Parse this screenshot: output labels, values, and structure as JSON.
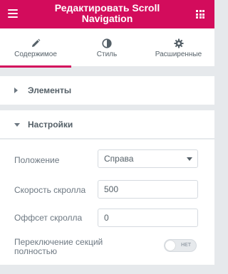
{
  "header": {
    "title": "Редактировать Scroll Navigation",
    "menu_icon": "hamburger-menu-icon",
    "grid_icon": "apps-grid-icon",
    "color": "#d30c5c"
  },
  "tabs": [
    {
      "label": "Содержимое",
      "icon": "pencil-icon",
      "active": true
    },
    {
      "label": "Стиль",
      "icon": "half-circle-icon",
      "active": false
    },
    {
      "label": "Расширенные",
      "icon": "gear-icon",
      "active": false
    }
  ],
  "sections": {
    "elements": {
      "title": "Элементы",
      "expanded": false
    },
    "settings": {
      "title": "Настройки",
      "expanded": true
    }
  },
  "settings": {
    "position": {
      "label": "Положение",
      "value": "Справа"
    },
    "scroll_speed": {
      "label": "Скорость скролла",
      "value": "500"
    },
    "scroll_offset": {
      "label": "Оффсет скролла",
      "value": "0"
    },
    "full_section": {
      "label": "Переключение секций полностью",
      "toggle_text": "НЕТ",
      "on": false
    }
  }
}
